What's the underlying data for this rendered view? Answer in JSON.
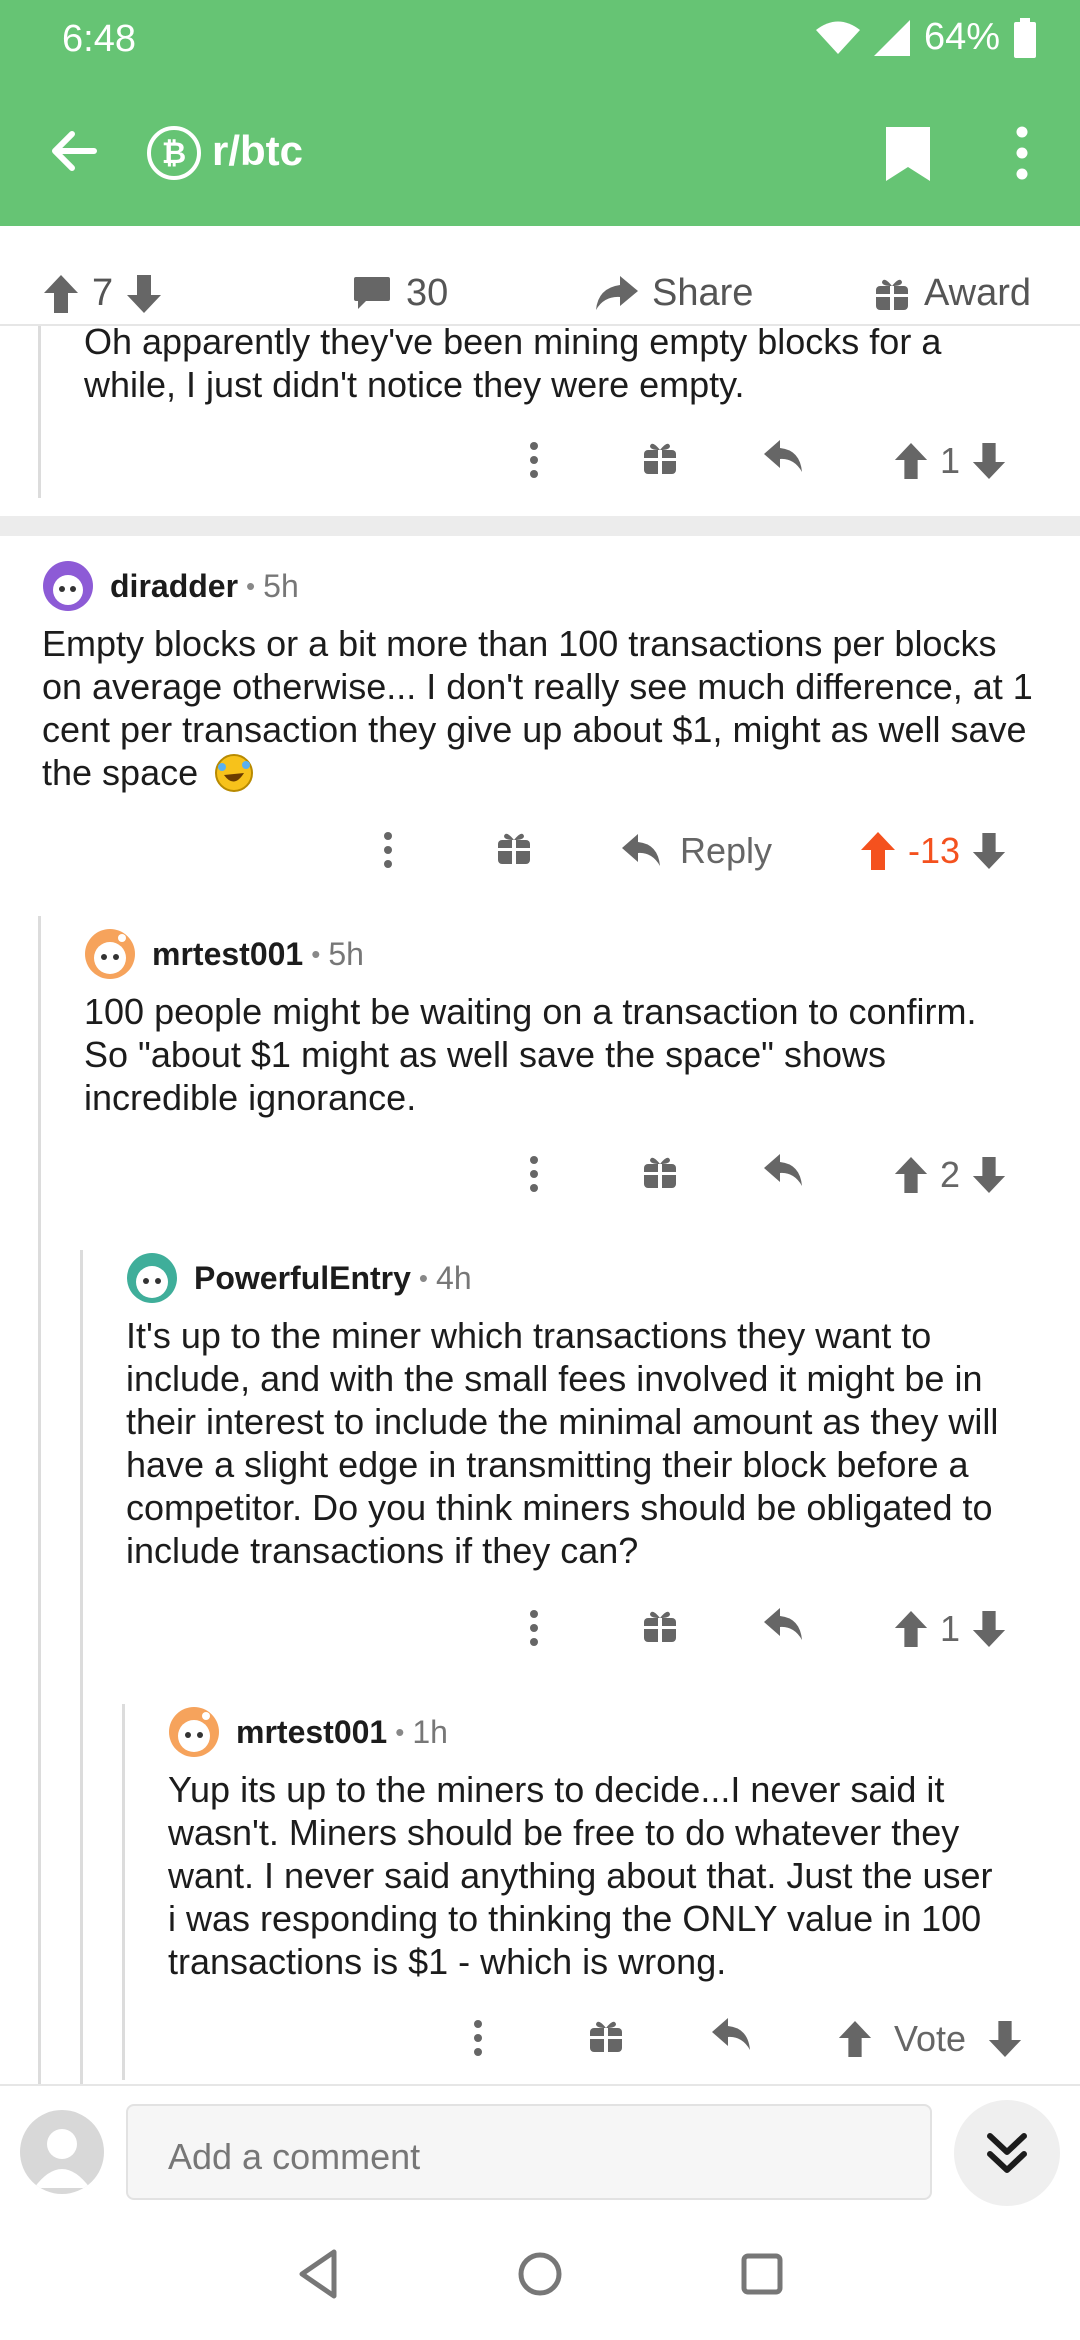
{
  "status_bar": {
    "time": "6:48",
    "battery": "64%"
  },
  "app_bar": {
    "subreddit": "r/btc",
    "icons": [
      "back-arrow-icon",
      "bitcoin-icon",
      "bookmark-icon",
      "more-vert-icon"
    ]
  },
  "post_bar": {
    "score": "7",
    "comments": "30",
    "share": "Share",
    "award": "Award"
  },
  "comments": [
    {
      "text_lines": [
        "Oh apparently they've been mining empty blocks for a",
        "while, I just didn't notice they were empty."
      ],
      "score": "1"
    },
    {
      "user": "diradder",
      "age": "5h",
      "text_lines": [
        "Empty blocks or a bit more than 100 transactions per blocks",
        "on average otherwise... I don't really see much difference, at 1",
        "cent per transaction they give up about $1, might as well save",
        "the space"
      ],
      "reply_label": "Reply",
      "score": "-13",
      "accent": "#f4511e"
    },
    {
      "user": "mrtest001",
      "age": "5h",
      "text_lines": [
        "100 people might be waiting on a transaction to confirm.",
        "So \"about $1 might as well save the space\" shows",
        "incredible ignorance."
      ],
      "score": "2"
    },
    {
      "user": "PowerfulEntry",
      "age": "4h",
      "text_lines": [
        "It's up to the miner which transactions they want to",
        "include, and with the small fees involved it might be in",
        "their interest to include the minimal amount as they will",
        "have a slight edge in transmitting their block before a",
        "competitor. Do you think miners should be obligated to",
        "include transactions if they can?"
      ],
      "score": "1"
    },
    {
      "user": "mrtest001",
      "age": "1h",
      "text_lines": [
        "Yup its up to the miners to decide...I never said it",
        "wasn't.  Miners should be free to do whatever they",
        "want.  I never said anything about that.  Just the user",
        "i was responding to thinking the ONLY value in 100",
        "transactions is $1 - which is wrong."
      ],
      "vote_label": "Vote"
    }
  ],
  "composer": {
    "placeholder": "Add a comment"
  },
  "colors": {
    "header": "#66c474",
    "downvoted": "#f4511e",
    "thread_line": "#dcdcdc"
  }
}
